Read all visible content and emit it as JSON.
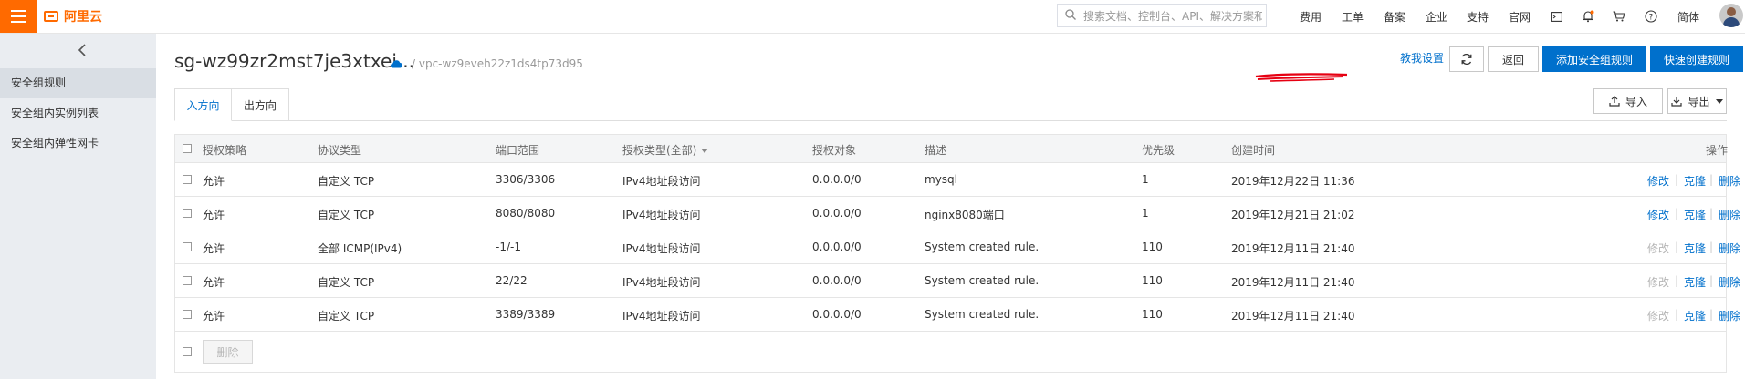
{
  "topbar": {
    "brand": "阿里云",
    "search_placeholder": "搜索文档、控制台、API、解决方案和",
    "nav": [
      "费用",
      "工单",
      "备案",
      "企业",
      "支持",
      "官网"
    ],
    "lang": "简体",
    "icons": [
      "menu-icon",
      "search-icon",
      "terminal-icon",
      "bell-icon",
      "cart-icon",
      "help-icon",
      "avatar"
    ]
  },
  "sidebar": {
    "items": [
      {
        "label": "安全组规则",
        "active": true
      },
      {
        "label": "安全组内实例列表",
        "active": false
      },
      {
        "label": "安全组内弹性网卡",
        "active": false
      }
    ]
  },
  "header": {
    "title": "sg-wz99zr2mst7je3xtxei...",
    "vpc_path": "/ vpc-wz9eveh22z1ds4tp73d95",
    "help_link": "教我设置",
    "back_label": "返回",
    "add_rule_label": "添加安全组规则",
    "quick_create_label": "快速创建规则",
    "annotation_color": "#e60012"
  },
  "tabs": [
    {
      "label": "入方向",
      "active": true
    },
    {
      "label": "出方向",
      "active": false
    }
  ],
  "toolbar": {
    "import_label": "导入",
    "export_label": "导出"
  },
  "table": {
    "columns": [
      "授权策略",
      "协议类型",
      "端口范围",
      "授权类型(全部)",
      "授权对象",
      "描述",
      "优先级",
      "创建时间",
      "操作"
    ],
    "rows": [
      {
        "policy": "允许",
        "protocol": "自定义 TCP",
        "port": "3306/3306",
        "auth_type": "IPv4地址段访问",
        "target": "0.0.0.0/0",
        "desc": "mysql",
        "priority": "1",
        "created": "2019年12月22日 11:36",
        "edit": "修改",
        "edit_enabled": true,
        "clone": "克隆",
        "delete": "删除"
      },
      {
        "policy": "允许",
        "protocol": "自定义 TCP",
        "port": "8080/8080",
        "auth_type": "IPv4地址段访问",
        "target": "0.0.0.0/0",
        "desc": "nginx8080端口",
        "priority": "1",
        "created": "2019年12月21日 21:02",
        "edit": "修改",
        "edit_enabled": true,
        "clone": "克隆",
        "delete": "删除"
      },
      {
        "policy": "允许",
        "protocol": "全部 ICMP(IPv4)",
        "port": "-1/-1",
        "auth_type": "IPv4地址段访问",
        "target": "0.0.0.0/0",
        "desc": "System created rule.",
        "priority": "110",
        "created": "2019年12月11日 21:40",
        "edit": "修改",
        "edit_enabled": false,
        "clone": "克隆",
        "delete": "删除"
      },
      {
        "policy": "允许",
        "protocol": "自定义 TCP",
        "port": "22/22",
        "auth_type": "IPv4地址段访问",
        "target": "0.0.0.0/0",
        "desc": "System created rule.",
        "priority": "110",
        "created": "2019年12月11日 21:40",
        "edit": "修改",
        "edit_enabled": false,
        "clone": "克隆",
        "delete": "删除"
      },
      {
        "policy": "允许",
        "protocol": "自定义 TCP",
        "port": "3389/3389",
        "auth_type": "IPv4地址段访问",
        "target": "0.0.0.0/0",
        "desc": "System created rule.",
        "priority": "110",
        "created": "2019年12月11日 21:40",
        "edit": "修改",
        "edit_enabled": false,
        "clone": "克隆",
        "delete": "删除"
      }
    ],
    "batch_delete_label": "删除"
  },
  "colors": {
    "brand_orange": "#ff6a00",
    "primary_blue": "#0070cc",
    "link_blue": "#0070cc",
    "disabled_gray": "#b5b5b5"
  }
}
